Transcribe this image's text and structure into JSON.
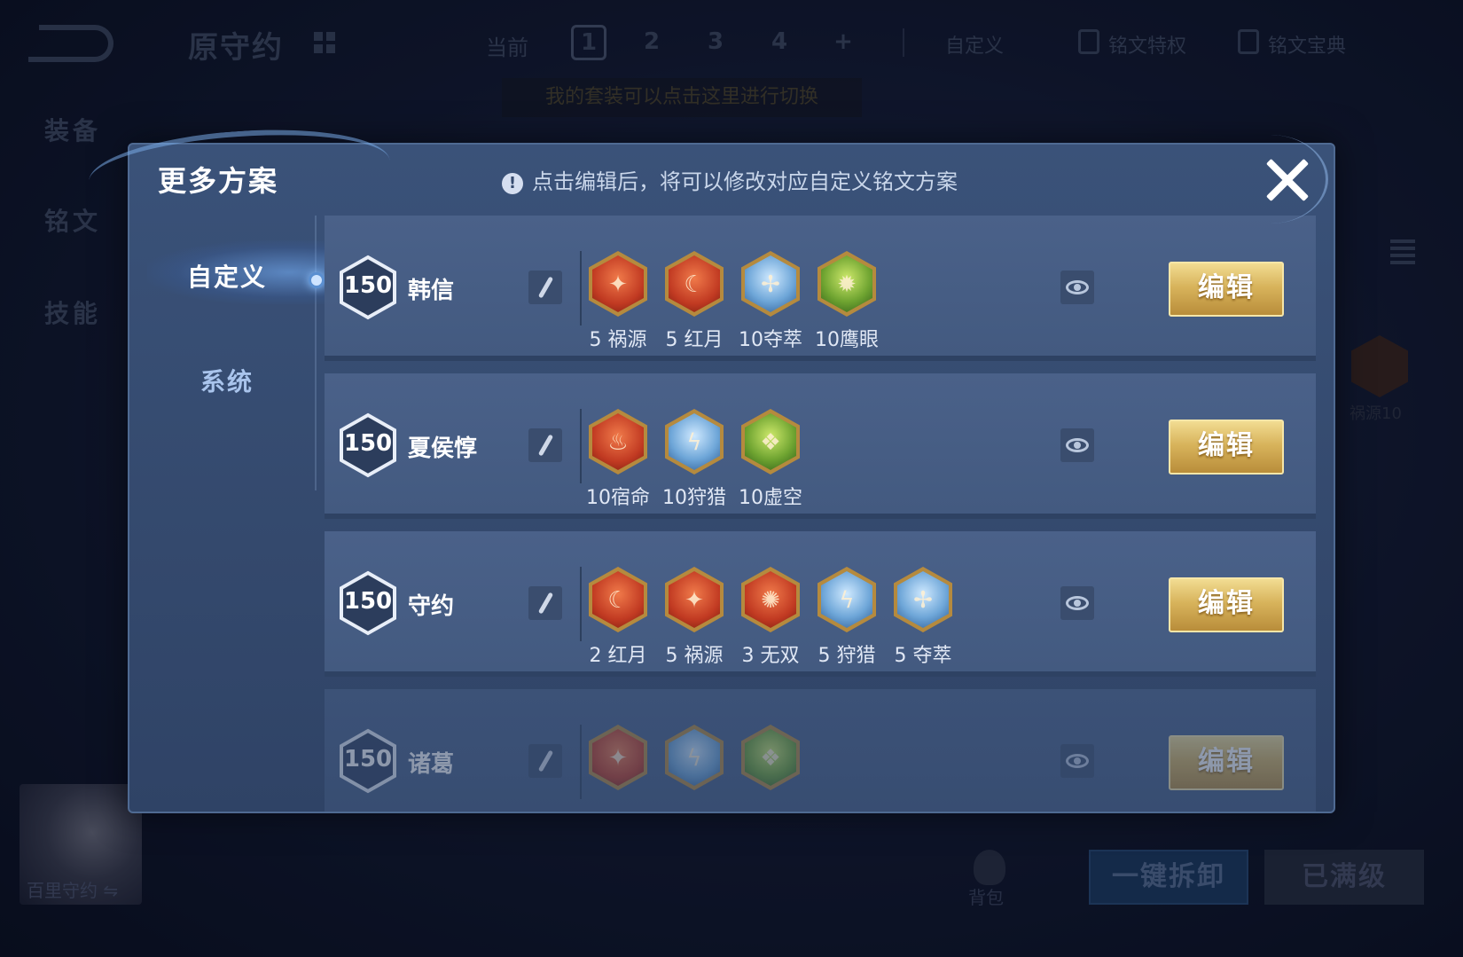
{
  "header": {
    "hero_title": "原守约",
    "current_label": "当前",
    "pages": [
      "1",
      "2",
      "3",
      "4",
      "+"
    ],
    "custom_label": "自定义",
    "privilege_label": "铭文特权",
    "codex_label": "铭文宝典",
    "banner": "我的套装可以点击这里进行切换"
  },
  "background_side": {
    "equip": "装备",
    "rune": "铭文",
    "skill": "技能"
  },
  "background_right": {
    "rune_label": "祸源10"
  },
  "hero_card": {
    "name": "百里守约 ⇋"
  },
  "bottom": {
    "bag": "背包",
    "unload": "一键拆卸",
    "maxed": "已满级"
  },
  "modal": {
    "title": "更多方案",
    "hint": "点击编辑后，将可以修改对应自定义铭文方案",
    "nav": {
      "custom": "自定义",
      "system": "系统"
    },
    "edit_label": "编辑",
    "plans": [
      {
        "level": "150",
        "name": "韩信",
        "runes": [
          {
            "label": "5 祸源",
            "color": "#c13a22",
            "icon": "fan-icon"
          },
          {
            "label": "5 红月",
            "color": "#c13a22",
            "icon": "moon-icon"
          },
          {
            "label": "10夺萃",
            "color": "#6ea6d8",
            "icon": "knot-icon"
          },
          {
            "label": "10鹰眼",
            "color": "#6fa431",
            "icon": "eye-star-icon"
          }
        ]
      },
      {
        "level": "150",
        "name": "夏侯惇",
        "runes": [
          {
            "label": "10宿命",
            "color": "#c13a22",
            "icon": "flame-icon"
          },
          {
            "label": "10狩猎",
            "color": "#6ea6d8",
            "icon": "lightning-icon"
          },
          {
            "label": "10虚空",
            "color": "#6fa431",
            "icon": "void-icon"
          }
        ]
      },
      {
        "level": "150",
        "name": "守约",
        "runes": [
          {
            "label": "2 红月",
            "color": "#c13a22",
            "icon": "moon-icon"
          },
          {
            "label": "5 祸源",
            "color": "#c13a22",
            "icon": "fan-icon"
          },
          {
            "label": "3 无双",
            "color": "#c13a22",
            "icon": "swirl-icon"
          },
          {
            "label": "5 狩猎",
            "color": "#6ea6d8",
            "icon": "lightning-icon"
          },
          {
            "label": "5 夺萃",
            "color": "#6ea6d8",
            "icon": "knot-icon"
          }
        ]
      },
      {
        "level": "150",
        "name": "诸葛",
        "runes": [
          {
            "label": "",
            "color": "#c13a22",
            "icon": "fan-icon"
          },
          {
            "label": "",
            "color": "#6ea6d8",
            "icon": "lightning-icon"
          },
          {
            "label": "",
            "color": "#6fa431",
            "icon": "void-icon"
          }
        ]
      }
    ]
  },
  "colors": {
    "accent_gold": "#d8b45c",
    "panel": "#34496d"
  }
}
